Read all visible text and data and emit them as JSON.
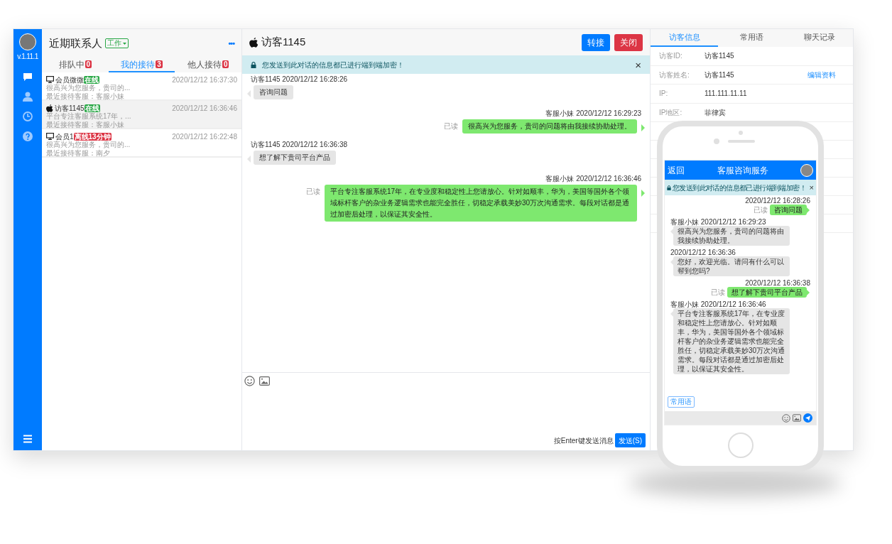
{
  "sidebar": {
    "version": "v.1.11.1",
    "nav": [
      {
        "kind": "chat",
        "selected": true
      },
      {
        "kind": "user",
        "selected": false
      },
      {
        "kind": "clock",
        "selected": false
      },
      {
        "kind": "help",
        "selected": false
      }
    ]
  },
  "contacts": {
    "title": "近期联系人",
    "mode": "工作",
    "more": "•••",
    "tabs": [
      {
        "label": "排队中",
        "count": "0",
        "selected": false
      },
      {
        "label": "我的接待",
        "count": "3",
        "selected": true
      },
      {
        "label": "他人接待",
        "count": "0",
        "selected": false
      }
    ],
    "items": [
      {
        "kind": "desktop",
        "name": "会员微微",
        "status": "在线",
        "color": "#28a745",
        "time": "2020/12/12 16:37:30",
        "preview": "很高兴为您服务，贵司的...",
        "agent": "最近接待客服：客服小妹",
        "selected": false
      },
      {
        "kind": "apple",
        "name": "访客1145",
        "status": "在线",
        "color": "#28a745",
        "time": "2020/12/12 16:36:46",
        "preview": "平台专注客服系统17年，...",
        "agent": "最近接待客服：客服小妹",
        "selected": true
      },
      {
        "kind": "desktop",
        "name": "会员1",
        "status": "离线13分钟",
        "color": "#dc3545",
        "time": "2020/12/12 16:22:48",
        "preview": "很高兴为您服务，贵司的...",
        "agent": "最近接待客服：南夕",
        "selected": false
      }
    ]
  },
  "chat": {
    "title": "访客1145",
    "buttons": [
      "转接",
      "关闭"
    ],
    "notice": "您发送到此对话的信息都已进行端到端加密！",
    "close": "×",
    "messages": [
      {
        "kind": "visitor",
        "meta": "访客1145 2020/12/12 16:28:26",
        "text": "咨询问题"
      },
      {
        "kind": "agent",
        "meta": "客服小妹 2020/12/12 16:29:23",
        "read": "已读",
        "text": "很高兴为您服务，贵司的问题将由我接续协助处理。"
      },
      {
        "kind": "visitor",
        "meta": "访客1145 2020/12/12 16:36:38",
        "text": "想了解下贵司平台产品"
      },
      {
        "kind": "agent",
        "meta": "客服小妹 2020/12/12 16:36:46",
        "read": "已读",
        "text": "平台专注客服系统17年，在专业度和稳定性上您请放心。针对如顺丰，华为，美国等国外各个领域标杆客户的杂业务逻辑需求也能完全胜任，切稳定承载美妙30万次沟通需求。每段对话都是通过加密后处理，以保证其安全性。"
      }
    ],
    "hint": "按Enter键发送消息",
    "send": "发送(S)"
  },
  "info": {
    "tabs": [
      {
        "label": "访客信息",
        "selected": true
      },
      {
        "label": "常用语",
        "selected": false
      },
      {
        "label": "聊天记录",
        "selected": false
      }
    ],
    "rows": [
      {
        "label": "访客ID:",
        "value": "访客1145"
      },
      {
        "label": "访客姓名:",
        "value": "访客1145",
        "action": "编辑资料"
      },
      {
        "label": "IP:",
        "value": "111.111.11.11"
      },
      {
        "label": "IP地区:",
        "value": "菲律宾"
      }
    ]
  },
  "phone": {
    "back": "返回",
    "title": "客服咨询服务",
    "notice": "您发送到此对话的信息都已进行端到端加密！",
    "close": "×",
    "messages": [
      {
        "kind": "self",
        "meta": "2020/12/12 16:28:26",
        "read": "已读",
        "text": "咨询问题"
      },
      {
        "kind": "other",
        "meta": "客服小妹 2020/12/12 16:29:23",
        "text": "很高兴为您服务，贵司的问题将由我接续协助处理。"
      },
      {
        "kind": "other",
        "meta": "2020/12/12 16:36:36",
        "text": "您好，欢迎光临。请问有什么可以帮到您吗?"
      },
      {
        "kind": "self",
        "meta": "2020/12/12 16:36:38",
        "read": "已读",
        "text": "想了解下贵司平台产品"
      },
      {
        "kind": "other",
        "meta": "客服小妹 2020/12/12 16:36:46",
        "text": "平台专注客服系统17年，在专业度和稳定性上您请放心。针对如顺丰，华为，美国等国外各个领域标杆客户的杂业务逻辑需求也能完全胜任，切稳定承载美妙30万次沟通需求。每段对话都是通过加密后处理，以保证其安全性。"
      }
    ],
    "quick": "常用语"
  }
}
